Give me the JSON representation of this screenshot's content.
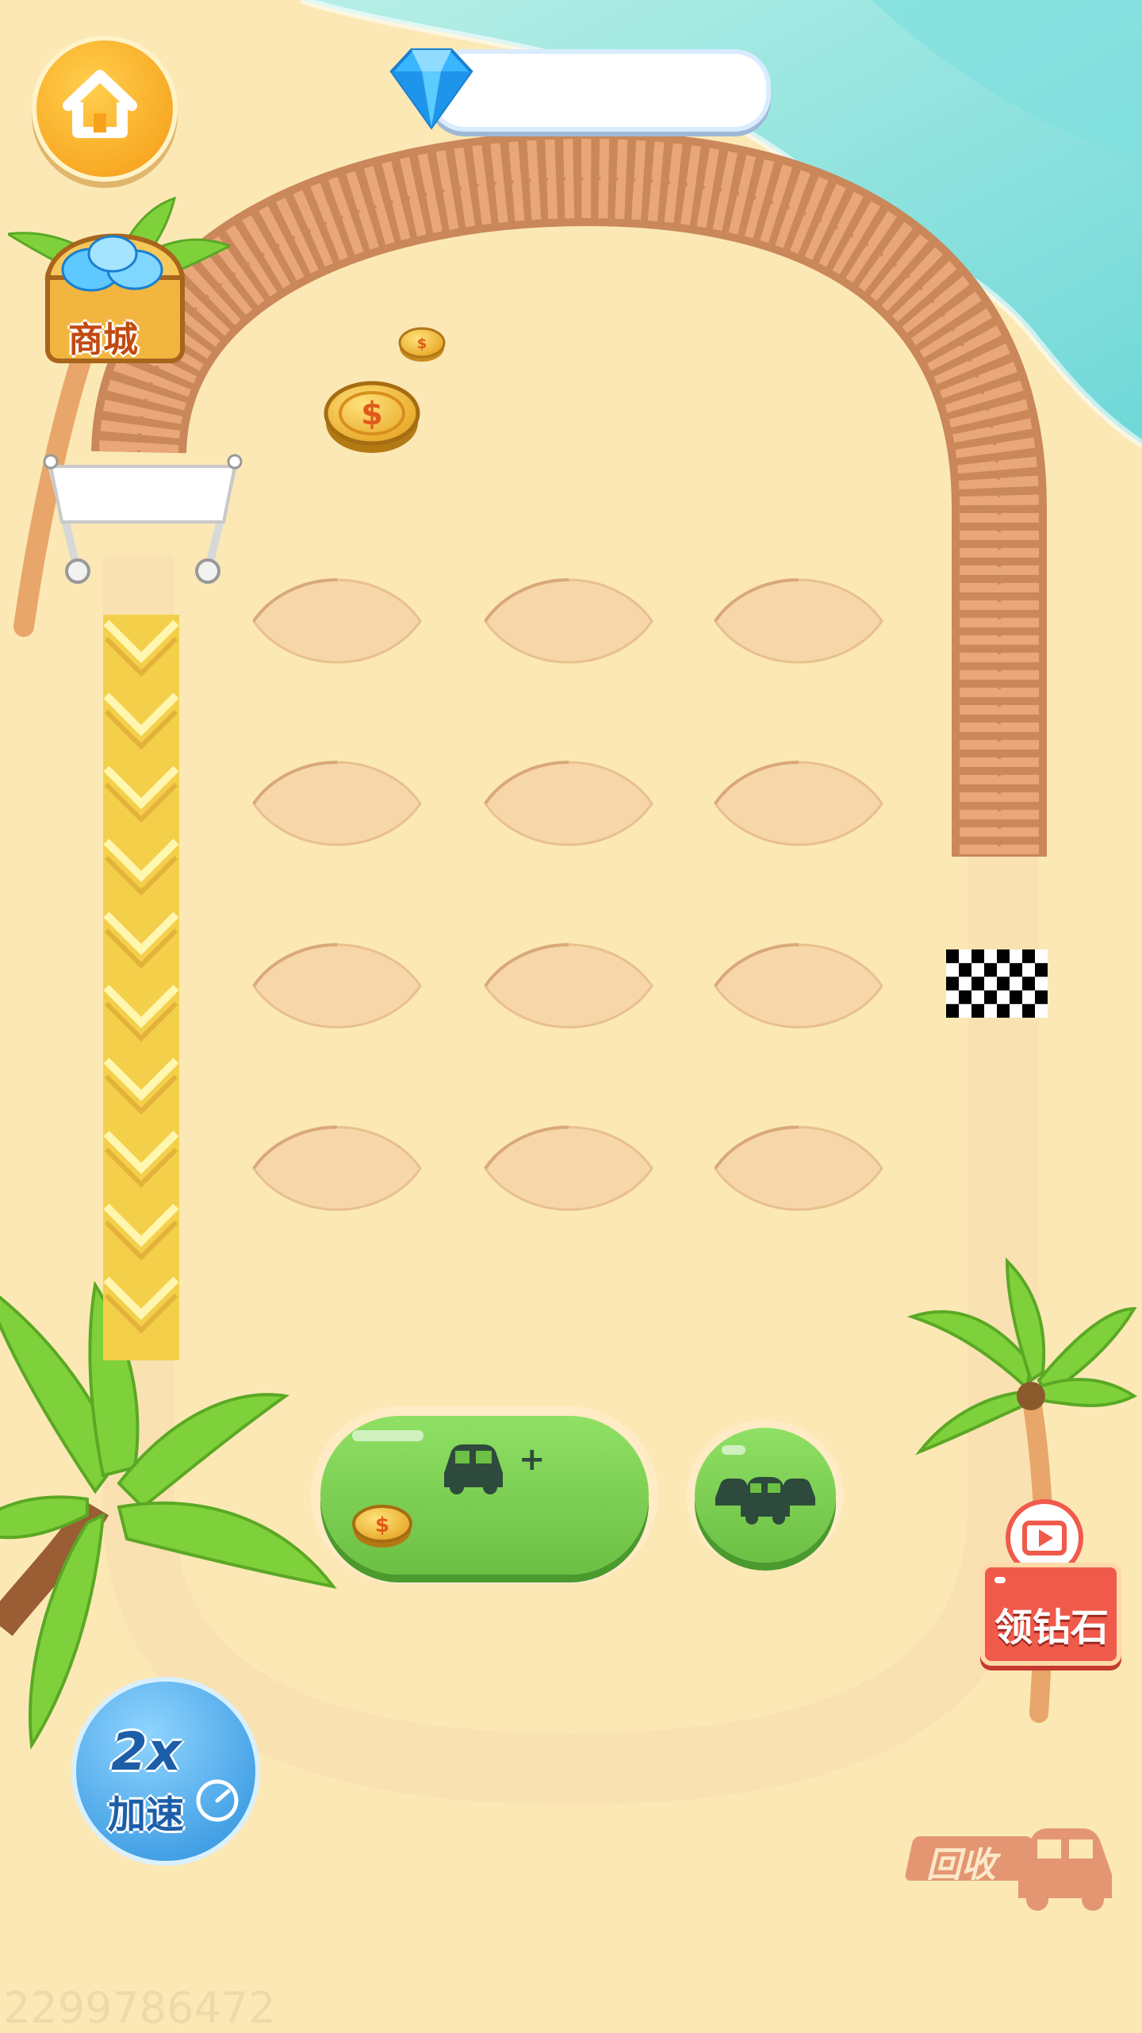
{
  "header": {
    "home_icon": "home-icon",
    "diamond_icon": "diamond-icon",
    "diamond_count": ""
  },
  "shop": {
    "label": "商城",
    "icon": "treasure-chest-icon"
  },
  "track": {
    "finish_icon": "checkered-flag-icon",
    "start_banner": ""
  },
  "coins": [
    {
      "name": "coin-small",
      "icon": "coin-dollar-icon"
    },
    {
      "name": "coin-large",
      "icon": "coin-dollar-icon"
    }
  ],
  "slots": {
    "rows": 4,
    "cols": 3
  },
  "buy_car": {
    "plus": "+",
    "price": "",
    "icon": "car-plus-icon"
  },
  "garage": {
    "icon": "cars-icon"
  },
  "diamond_reward": {
    "label": "领钻石",
    "icon": "video-play-icon"
  },
  "speed": {
    "multiplier": "2x",
    "label": "加速"
  },
  "recycle": {
    "label": "回收",
    "icon": "car-icon"
  },
  "watermark": "2299786472",
  "colors": {
    "sand": "#fbe8b5",
    "sea": "#8fe3df",
    "green_button": "#7fd35a",
    "orange_home": "#f6a21c",
    "red_badge": "#f05a4b",
    "blue_speed": "#3aa6e8"
  }
}
